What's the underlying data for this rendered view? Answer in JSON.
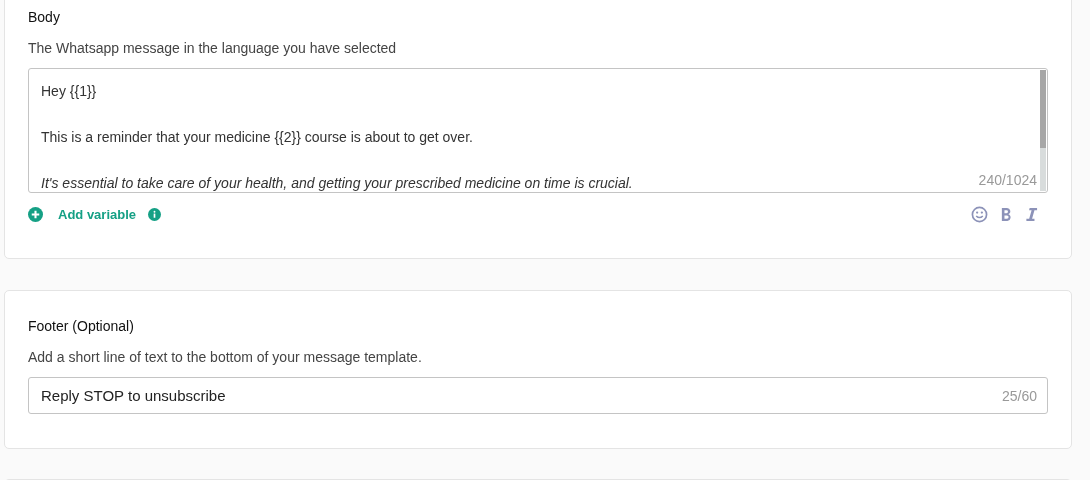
{
  "body_section": {
    "title": "Body",
    "description": "The Whatsapp message in the language you have selected",
    "message_lines": [
      {
        "text": "Hey {{1}}",
        "italic": false
      },
      {
        "text": "This is a reminder that your medicine {{2}} course is about to get over.",
        "italic": false
      },
      {
        "text": "It's essential to take care of your health, and getting your prescribed medicine on time is crucial.",
        "italic": true
      }
    ],
    "counter": "240/1024",
    "add_variable": "Add variable"
  },
  "footer_section": {
    "title": "Footer (Optional)",
    "description": "Add a short line of text to the bottom of your message template.",
    "value": "Reply STOP to unsubscribe",
    "counter": "25/60"
  }
}
